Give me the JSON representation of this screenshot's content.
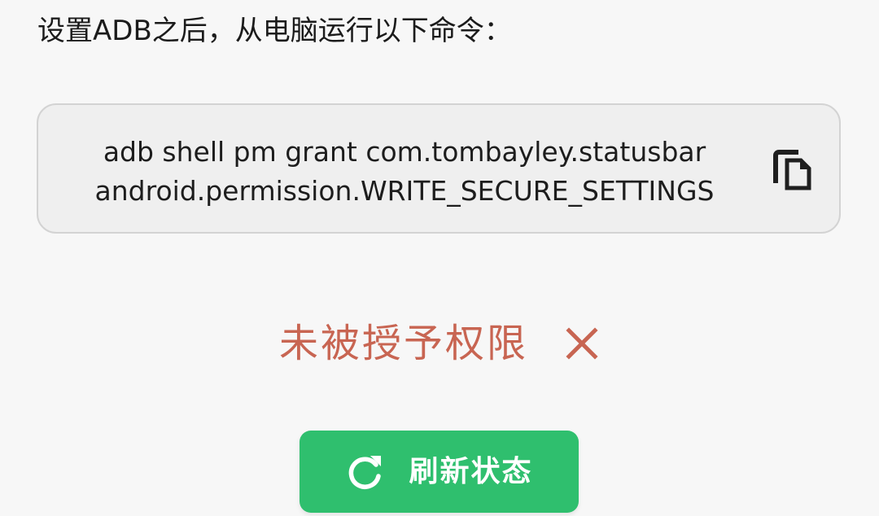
{
  "instruction": "设置ADB之后，从电脑运行以下命令：",
  "command": {
    "line1": "adb shell pm grant com.tombayley.statusbar",
    "line2": "android.permission.WRITE_SECURE_SETTINGS",
    "copy_icon": "copy-icon"
  },
  "status": {
    "text": "未被授予权限",
    "icon": "close-icon",
    "color": "#c86552"
  },
  "refresh_button": {
    "label": "刷新状态",
    "icon": "refresh-icon",
    "color": "#2fbf6e"
  }
}
